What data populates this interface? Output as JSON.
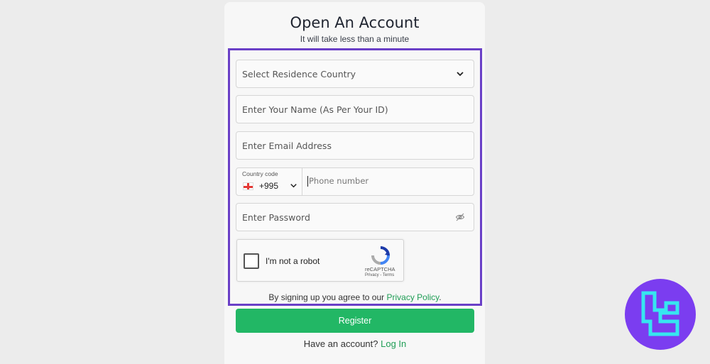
{
  "form": {
    "title": "Open An Account",
    "subtitle": "It will take less than a minute",
    "country_select": {
      "placeholder": "Select Residence Country"
    },
    "name_field": {
      "placeholder": "Enter Your Name (As Per Your ID)"
    },
    "email_field": {
      "placeholder": "Enter Email Address"
    },
    "phone": {
      "country_code_label": "Country code",
      "country_code_value": "+995",
      "placeholder": "Phone number"
    },
    "password_field": {
      "placeholder": "Enter Password"
    },
    "recaptcha": {
      "label": "I'm not a robot",
      "brand": "reCAPTCHA",
      "terms": "Privacy - Terms"
    },
    "agree": {
      "text": "By signing up you agree to our",
      "link": "Privacy Policy",
      "period": "."
    },
    "register_button": "Register",
    "login": {
      "text": "Have an account?",
      "link": "Log In"
    }
  },
  "colors": {
    "accent_green": "#22b765",
    "highlight_purple": "#6a3fc7",
    "badge_purple": "#7b3df0",
    "badge_logo": "#36e6f0"
  },
  "icons": {
    "select": "chevron-down-icon",
    "password": "eye-slash-icon",
    "flag": "georgia-flag-icon",
    "badge": "site-logo-icon"
  }
}
